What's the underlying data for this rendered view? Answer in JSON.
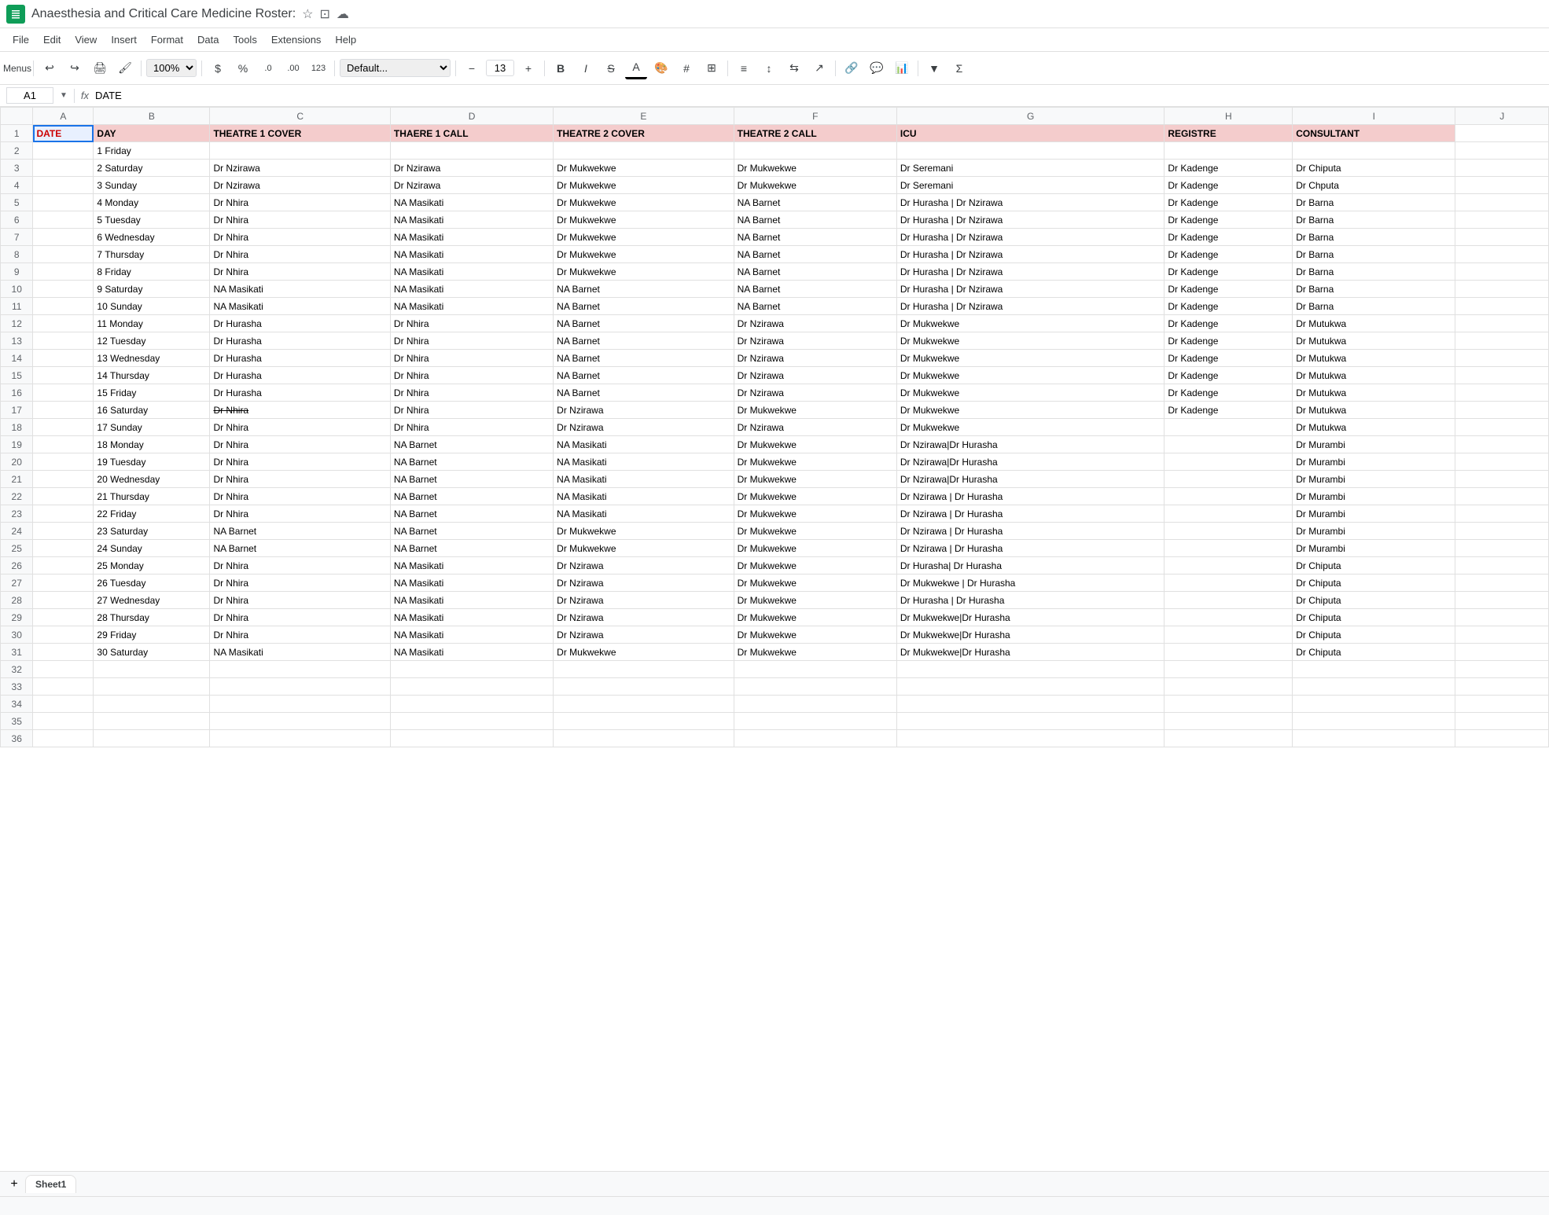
{
  "app": {
    "icon_color": "#0F9D58",
    "title": "Anaesthesia and Critical Care Medicine Roster:",
    "menu_items": [
      "File",
      "Edit",
      "View",
      "Insert",
      "Format",
      "Data",
      "Tools",
      "Extensions",
      "Help"
    ],
    "toolbar": {
      "menus_label": "Menus",
      "zoom": "100%",
      "currency_symbol": "$",
      "percent_symbol": "%",
      "decimal_decrease": ".0",
      "decimal_increase": ".00",
      "format_123": "123",
      "font_name": "Default...",
      "font_size_minus": "−",
      "font_size": "13",
      "font_size_plus": "+"
    },
    "formula_bar": {
      "cell_ref": "A1",
      "formula": "DATE"
    }
  },
  "columns": {
    "headers": [
      "A",
      "B",
      "C",
      "D",
      "E",
      "F",
      "G",
      "H",
      "I",
      "J"
    ],
    "col_letters": {
      "rn": "",
      "a": "A",
      "b": "B",
      "c": "C",
      "d": "D",
      "e": "E",
      "f": "F",
      "g": "G",
      "h": "H",
      "i": "I",
      "j": "J"
    }
  },
  "header_row": {
    "date": "DATE",
    "day": "DAY",
    "theatre1cover": "THEATRE 1 COVER",
    "theatre1call": "THAERE 1 CALL",
    "theatre2cover": "THEATRE 2 COVER",
    "theatre2call": "THEATRE 2 CALL",
    "icu": "ICU",
    "registre": "REGISTRE",
    "consultant": "CONSULTANT"
  },
  "rows": [
    {
      "rn": "2",
      "date": "",
      "day": "1 Friday",
      "c": "",
      "d": "",
      "e": "",
      "f": "",
      "g": "",
      "h": "",
      "i": ""
    },
    {
      "rn": "3",
      "date": "",
      "day": "2 Saturday",
      "c": "Dr Nzirawa",
      "d": "Dr Nzirawa",
      "e": "Dr Mukwekwe",
      "f": "Dr Mukwekwe",
      "g": "Dr Seremani",
      "h": "Dr Kadenge",
      "i": "Dr Chiputa"
    },
    {
      "rn": "4",
      "date": "",
      "day": "3 Sunday",
      "c": "Dr Nzirawa",
      "d": "Dr Nzirawa",
      "e": "Dr Mukwekwe",
      "f": "Dr Mukwekwe",
      "g": "Dr Seremani",
      "h": "Dr Kadenge",
      "i": "Dr Chputa"
    },
    {
      "rn": "5",
      "date": "",
      "day": "4 Monday",
      "c": "Dr Nhira",
      "d": "NA Masikati",
      "e": "Dr Mukwekwe",
      "f": "NA Barnet",
      "g": "Dr Hurasha | Dr Nzirawa",
      "h": "Dr Kadenge",
      "i": "Dr Barna"
    },
    {
      "rn": "6",
      "date": "",
      "day": "5 Tuesday",
      "c": "Dr Nhira",
      "d": "NA Masikati",
      "e": "Dr Mukwekwe",
      "f": "NA Barnet",
      "g": "Dr Hurasha | Dr Nzirawa",
      "h": "Dr Kadenge",
      "i": "Dr Barna"
    },
    {
      "rn": "7",
      "date": "",
      "day": "6 Wednesday",
      "c": "Dr Nhira",
      "d": "NA Masikati",
      "e": "Dr Mukwekwe",
      "f": "NA Barnet",
      "g": "Dr Hurasha | Dr Nzirawa",
      "h": "Dr Kadenge",
      "i": "Dr Barna"
    },
    {
      "rn": "8",
      "date": "",
      "day": "7 Thursday",
      "c": "Dr Nhira",
      "d": "NA Masikati",
      "e": "Dr Mukwekwe",
      "f": "NA Barnet",
      "g": "Dr Hurasha | Dr Nzirawa",
      "h": "Dr Kadenge",
      "i": "Dr Barna"
    },
    {
      "rn": "9",
      "date": "",
      "day": "8 Friday",
      "c": "Dr Nhira",
      "d": "NA Masikati",
      "e": "Dr Mukwekwe",
      "f": "NA Barnet",
      "g": "Dr Hurasha | Dr Nzirawa",
      "h": "Dr Kadenge",
      "i": "Dr Barna"
    },
    {
      "rn": "10",
      "date": "",
      "day": "9 Saturday",
      "c": "NA Masikati",
      "d": "NA Masikati",
      "e": "NA Barnet",
      "f": "NA Barnet",
      "g": "Dr Hurasha | Dr Nzirawa",
      "h": "Dr Kadenge",
      "i": "Dr Barna"
    },
    {
      "rn": "11",
      "date": "",
      "day": "10 Sunday",
      "c": "NA Masikati",
      "d": "NA Masikati",
      "e": "NA Barnet",
      "f": "NA Barnet",
      "g": "Dr Hurasha | Dr Nzirawa",
      "h": "Dr Kadenge",
      "i": "Dr Barna"
    },
    {
      "rn": "12",
      "date": "",
      "day": "11 Monday",
      "c": "Dr Hurasha",
      "d": "Dr Nhira",
      "e": "NA Barnet",
      "f": "Dr Nzirawa",
      "g": "Dr Mukwekwe",
      "h": "Dr Kadenge",
      "i": "Dr Mutukwa"
    },
    {
      "rn": "13",
      "date": "",
      "day": "12 Tuesday",
      "c": "Dr Hurasha",
      "d": "Dr Nhira",
      "e": "NA Barnet",
      "f": "Dr Nzirawa",
      "g": "Dr Mukwekwe",
      "h": "Dr Kadenge",
      "i": "Dr Mutukwa"
    },
    {
      "rn": "14",
      "date": "",
      "day": "13 Wednesday",
      "c": "Dr Hurasha",
      "d": "Dr Nhira",
      "e": "NA Barnet",
      "f": "Dr Nzirawa",
      "g": "Dr Mukwekwe",
      "h": "Dr Kadenge",
      "i": "Dr Mutukwa"
    },
    {
      "rn": "15",
      "date": "",
      "day": "14 Thursday",
      "c": "Dr Hurasha",
      "d": "Dr Nhira",
      "e": "NA Barnet",
      "f": "Dr Nzirawa",
      "g": "Dr Mukwekwe",
      "h": "Dr Kadenge",
      "i": "Dr Mutukwa"
    },
    {
      "rn": "16",
      "date": "",
      "day": "15 Friday",
      "c": "Dr Hurasha",
      "d": "Dr Nhira",
      "e": "NA Barnet",
      "f": "Dr Nzirawa",
      "g": "Dr Mukwekwe",
      "h": "Dr Kadenge",
      "i": "Dr Mutukwa"
    },
    {
      "rn": "17",
      "date": "",
      "day": "16 Saturday",
      "c": "Dr Nhira (strike)",
      "d": "Dr Nhira",
      "e": "Dr Nzirawa",
      "f": "Dr Mukwekwe",
      "g": "Dr Mukwekwe",
      "h": "Dr Kadenge",
      "i": "Dr Mutukwa"
    },
    {
      "rn": "18",
      "date": "",
      "day": "17 Sunday",
      "c": "Dr Nhira",
      "d": "Dr Nhira",
      "e": "Dr Nzirawa",
      "f": "Dr Nzirawa",
      "g": "Dr Mukwekwe",
      "h": "",
      "i": "Dr Mutukwa"
    },
    {
      "rn": "19",
      "date": "",
      "day": "18 Monday",
      "c": "Dr Nhira",
      "d": "NA Barnet",
      "e": "NA Masikati",
      "f": "Dr Mukwekwe",
      "g": "Dr Nzirawa|Dr Hurasha",
      "h": "",
      "i": "Dr Murambi"
    },
    {
      "rn": "20",
      "date": "",
      "day": "19 Tuesday",
      "c": "Dr Nhira",
      "d": "NA Barnet",
      "e": "NA Masikati",
      "f": "Dr Mukwekwe",
      "g": "Dr Nzirawa|Dr Hurasha",
      "h": "",
      "i": "Dr Murambi"
    },
    {
      "rn": "21",
      "date": "",
      "day": "20 Wednesday",
      "c": "Dr Nhira",
      "d": "NA Barnet",
      "e": "NA Masikati",
      "f": "Dr Mukwekwe",
      "g": "Dr Nzirawa|Dr Hurasha",
      "h": "",
      "i": "Dr Murambi"
    },
    {
      "rn": "22",
      "date": "",
      "day": "21 Thursday",
      "c": "Dr Nhira",
      "d": "NA Barnet",
      "e": "NA Masikati",
      "f": "Dr Mukwekwe",
      "g": "Dr Nzirawa | Dr Hurasha",
      "h": "",
      "i": "Dr Murambi"
    },
    {
      "rn": "23",
      "date": "",
      "day": "22 Friday",
      "c": "Dr Nhira",
      "d": "NA Barnet",
      "e": "NA Masikati",
      "f": "Dr Mukwekwe",
      "g": "Dr Nzirawa | Dr Hurasha",
      "h": "",
      "i": "Dr Murambi"
    },
    {
      "rn": "24",
      "date": "",
      "day": "23 Saturday",
      "c": "NA Barnet",
      "d": "NA Barnet",
      "e": "Dr Mukwekwe",
      "f": "Dr Mukwekwe",
      "g": "Dr Nzirawa | Dr Hurasha",
      "h": "",
      "i": "Dr Murambi"
    },
    {
      "rn": "25",
      "date": "",
      "day": "24 Sunday",
      "c": "NA Barnet",
      "d": "NA Barnet",
      "e": "Dr Mukwekwe",
      "f": "Dr Mukwekwe",
      "g": "Dr Nzirawa | Dr Hurasha",
      "h": "",
      "i": "Dr Murambi"
    },
    {
      "rn": "26",
      "date": "",
      "day": "25 Monday",
      "c": "Dr Nhira",
      "d": "NA Masikati",
      "e": "Dr Nzirawa",
      "f": "Dr Mukwekwe",
      "g": "Dr Hurasha| Dr Hurasha",
      "h": "",
      "i": "Dr Chiputa"
    },
    {
      "rn": "27",
      "date": "",
      "day": "26 Tuesday",
      "c": "Dr Nhira",
      "d": "NA Masikati",
      "e": "Dr Nzirawa",
      "f": "Dr Mukwekwe",
      "g": "Dr Mukwekwe | Dr Hurasha",
      "h": "",
      "i": "Dr Chiputa"
    },
    {
      "rn": "28",
      "date": "",
      "day": "27 Wednesday",
      "c": "Dr Nhira",
      "d": "NA Masikati",
      "e": "Dr Nzirawa",
      "f": "Dr Mukwekwe",
      "g": "Dr Hurasha | Dr Hurasha",
      "h": "",
      "i": "Dr Chiputa"
    },
    {
      "rn": "29",
      "date": "",
      "day": "28 Thursday",
      "c": "Dr Nhira",
      "d": "NA Masikati",
      "e": "Dr Nzirawa",
      "f": "Dr Mukwekwe",
      "g": "Dr Mukwekwe|Dr Hurasha",
      "h": "",
      "i": "Dr Chiputa"
    },
    {
      "rn": "30",
      "date": "",
      "day": "29 Friday",
      "c": "Dr Nhira",
      "d": "NA Masikati",
      "e": "Dr Nzirawa",
      "f": "Dr Mukwekwe",
      "g": "Dr Mukwekwe|Dr Hurasha",
      "h": "",
      "i": "Dr Chiputa"
    },
    {
      "rn": "31",
      "date": "",
      "day": "30 Saturday",
      "c": "NA Masikati",
      "d": "NA Masikati",
      "e": "Dr Mukwekwe",
      "f": "Dr Mukwekwe",
      "g": "Dr Mukwekwe|Dr Hurasha",
      "h": "",
      "i": "Dr Chiputa"
    },
    {
      "rn": "32",
      "date": "",
      "day": "",
      "c": "",
      "d": "",
      "e": "",
      "f": "",
      "g": "",
      "h": "",
      "i": ""
    },
    {
      "rn": "33",
      "date": "",
      "day": "",
      "c": "",
      "d": "",
      "e": "",
      "f": "",
      "g": "",
      "h": "",
      "i": ""
    },
    {
      "rn": "34",
      "date": "",
      "day": "",
      "c": "",
      "d": "",
      "e": "",
      "f": "",
      "g": "",
      "h": "",
      "i": ""
    },
    {
      "rn": "35",
      "date": "",
      "day": "",
      "c": "",
      "d": "",
      "e": "",
      "f": "",
      "g": "",
      "h": "",
      "i": ""
    },
    {
      "rn": "36",
      "date": "",
      "day": "",
      "c": "",
      "d": "",
      "e": "",
      "f": "",
      "g": "",
      "h": "",
      "i": ""
    }
  ],
  "sheet_tab": "Sheet1",
  "status_bar_text": ""
}
